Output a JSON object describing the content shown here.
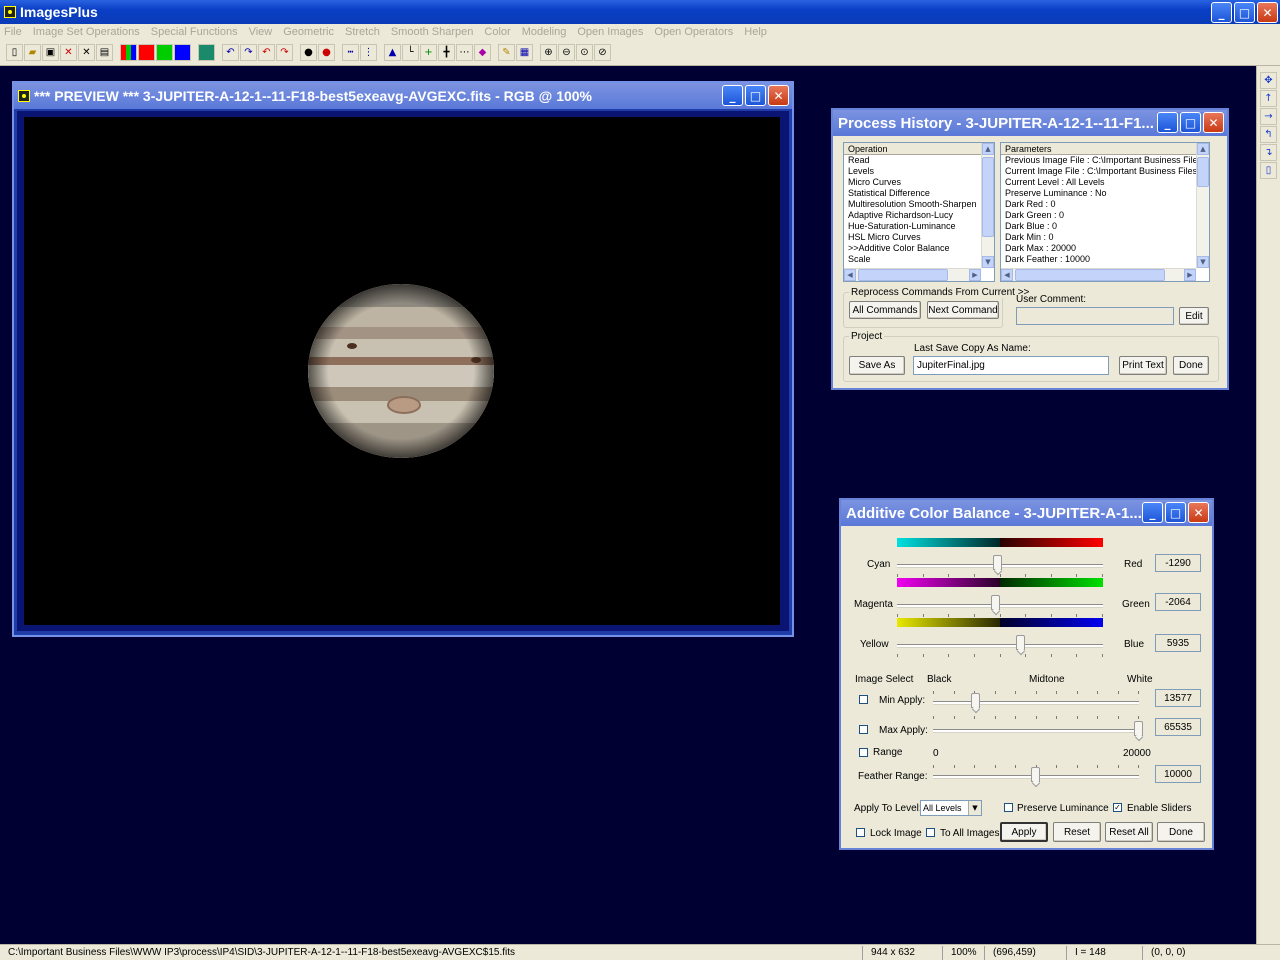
{
  "app": {
    "title": "ImagesPlus",
    "window_buttons": {
      "minimize": "_",
      "maximize": "□",
      "close": "✕"
    }
  },
  "menu": [
    "File",
    "Image Set Operations",
    "Special Functions",
    "View",
    "Geometric",
    "Stretch",
    "Smooth Sharpen",
    "Color",
    "Modeling",
    "Open Images",
    "Open Operators",
    "Help"
  ],
  "toolbar_icons": [
    "new-icon",
    "open-icon",
    "save-icon",
    "close-x-icon",
    "close-all-icon",
    "print-icon",
    "rgb-icon",
    "red-icon",
    "green-icon",
    "blue-icon",
    "grid-icon",
    "undo-icon",
    "redo-icon",
    "undo-all-icon",
    "redo-all-icon",
    "star-icon",
    "star-select-icon",
    "line-icon",
    "network-icon",
    "histogram-icon",
    "levels-icon",
    "cross-icon",
    "crosshair-icon",
    "dotgrid-icon",
    "paint-icon",
    "pencil-icon",
    "table-icon",
    "zoom-in-icon",
    "zoom-out-icon",
    "zoom-fit-icon",
    "zoom-100-icon"
  ],
  "right_toolbar_icons": [
    "move-icon",
    "arrow-up-icon",
    "arrow-right-icon",
    "rotate-left-icon",
    "rotate-right-icon",
    "copy-icon"
  ],
  "preview": {
    "title": "*** PREVIEW *** 3-JUPITER-A-12-1--11-F18-best5exeavg-AVGEXC.fits - RGB @  100%"
  },
  "process_history": {
    "title": "Process History - 3-JUPITER-A-12-1--11-F1...",
    "operation_header": "Operation",
    "operations": [
      "Read",
      "Levels",
      "Micro Curves",
      "Statistical Difference",
      "Multiresolution Smooth-Sharpen",
      "Adaptive Richardson-Lucy",
      "Hue-Saturation-Luminance",
      "HSL Micro Curves",
      ">>Additive Color Balance",
      "Scale"
    ],
    "parameters_header": "Parameters",
    "parameters": [
      "Previous Image File : C:\\Important Business Files\\W",
      "Current Image File : C:\\Important Business Files\\WV",
      "Current Level : All Levels",
      "Preserve Luminance : No",
      "Dark Red : 0",
      "Dark Green : 0",
      "Dark Blue : 0",
      "Dark Min : 0",
      "Dark Max : 20000",
      "Dark Feather : 10000"
    ],
    "reprocess_label": "Reprocess Commands From Current >>",
    "all_commands": "All Commands",
    "next_command": "Next Command",
    "user_comment_label": "User Comment:",
    "user_comment_value": "",
    "edit": "Edit",
    "project_label": "Project",
    "last_save_label": "Last Save Copy As Name:",
    "save_as": "Save As",
    "last_save_value": "JupiterFinal.jpg",
    "print_text": "Print Text",
    "done": "Done"
  },
  "color_balance": {
    "title": "Additive Color Balance - 3-JUPITER-A-1...",
    "cyan": "Cyan",
    "red": "Red",
    "red_value": "-1290",
    "red_slider": 0.49,
    "magenta": "Magenta",
    "green": "Green",
    "green_value": "-2064",
    "green_slider": 0.48,
    "yellow": "Yellow",
    "blue": "Blue",
    "blue_value": "5935",
    "blue_slider": 0.6,
    "image_select": "Image Select",
    "black": "Black",
    "midtone": "Midtone",
    "white": "White",
    "min_apply": "Min Apply:",
    "min_value": "13577",
    "min_slider": 0.21,
    "min_checked": false,
    "max_apply": "Max Apply:",
    "max_value": "65535",
    "max_slider": 1.0,
    "max_checked": false,
    "range": "Range",
    "range_min": "0",
    "range_max": "20000",
    "range_checked": false,
    "feather_range": "Feather Range:",
    "feather_value": "10000",
    "feather_slider": 0.5,
    "apply_to_level": "Apply To Level:",
    "level_value": "All Levels",
    "preserve_luminance": "Preserve Luminance",
    "preserve_checked": false,
    "enable_sliders": "Enable Sliders",
    "enable_checked": true,
    "lock_image": "Lock Image",
    "lock_checked": false,
    "to_all_images": "To All Images",
    "to_all_checked": false,
    "apply": "Apply",
    "reset": "Reset",
    "reset_all": "Reset All",
    "done": "Done"
  },
  "status": {
    "path": "C:\\Important Business Files\\WWW IP3\\process\\IP4\\SID\\3-JUPITER-A-12-1--11-F18-best5exeavg-AVGEXC$15.fits",
    "dimensions": "944 x 632",
    "zoom": "100%",
    "cursor": "(696,459)",
    "intensity": "I = 148",
    "rgb": "(0, 0, 0)"
  }
}
